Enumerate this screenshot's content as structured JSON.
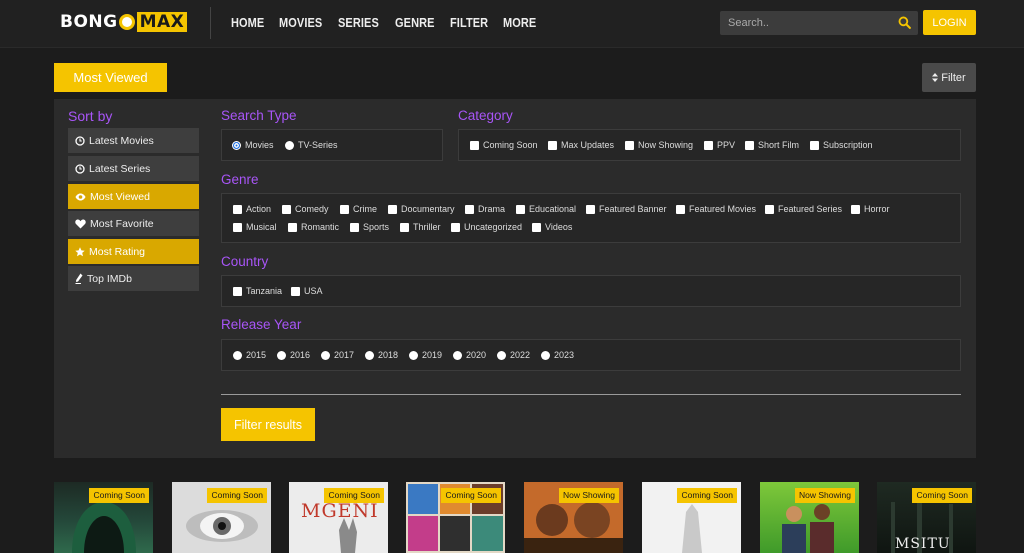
{
  "brand": {
    "part1": "BONG",
    "part2": "MAX"
  },
  "nav": [
    "HOME",
    "MOVIES",
    "SERIES",
    "GENRE",
    "FILTER",
    "MORE"
  ],
  "search": {
    "placeholder": "Search.."
  },
  "login_label": "LOGIN",
  "most_viewed_tab": "Most Viewed",
  "filter_button": "Filter",
  "sort": {
    "title": "Sort by",
    "items": [
      {
        "label": "Latest Movies",
        "icon": "clock-icon",
        "active": false
      },
      {
        "label": "Latest Series",
        "icon": "clock-icon",
        "active": false
      },
      {
        "label": "Most Viewed",
        "icon": "eye-icon",
        "active": true
      },
      {
        "label": "Most Favorite",
        "icon": "heart-icon",
        "active": false
      },
      {
        "label": "Most Rating",
        "icon": "star-icon",
        "active": true
      },
      {
        "label": "Top IMDb",
        "icon": "pen-icon",
        "active": false
      }
    ]
  },
  "search_type": {
    "title": "Search Type",
    "options": [
      "Movies",
      "TV-Series"
    ],
    "selected": "Movies"
  },
  "category": {
    "title": "Category",
    "options": [
      "Coming Soon",
      "Max Updates",
      "Now Showing",
      "PPV",
      "Short Film",
      "Subscription"
    ]
  },
  "genre": {
    "title": "Genre",
    "row1": [
      "Action",
      "Comedy",
      "Crime",
      "Documentary",
      "Drama",
      "Educational",
      "Featured Banner",
      "Featured Movies",
      "Featured Series",
      "Horror"
    ],
    "row2": [
      "Musical",
      "Romantic",
      "Sports",
      "Thriller",
      "Uncategorized",
      "Videos"
    ]
  },
  "country": {
    "title": "Country",
    "options": [
      "Tanzania",
      "USA"
    ]
  },
  "release_year": {
    "title": "Release Year",
    "options": [
      "2015",
      "2016",
      "2017",
      "2018",
      "2019",
      "2020",
      "2022",
      "2023"
    ]
  },
  "filter_results_label": "Filter results",
  "posters": [
    {
      "badge": "Coming Soon",
      "title_text": ""
    },
    {
      "badge": "Coming Soon",
      "title_text": ""
    },
    {
      "badge": "Coming Soon",
      "title_text": "MGENI"
    },
    {
      "badge": "Coming Soon",
      "title_text": ""
    },
    {
      "badge": "Now Showing",
      "title_text": ""
    },
    {
      "badge": "Coming Soon",
      "title_text": ""
    },
    {
      "badge": "Now Showing",
      "title_text": ""
    },
    {
      "badge": "Coming Soon",
      "title_text": "MSITU"
    }
  ],
  "colors": {
    "accent": "#f5c400",
    "purple": "#a855f7",
    "bg": "#1c1c1c",
    "panel": "#2b2b2b"
  }
}
